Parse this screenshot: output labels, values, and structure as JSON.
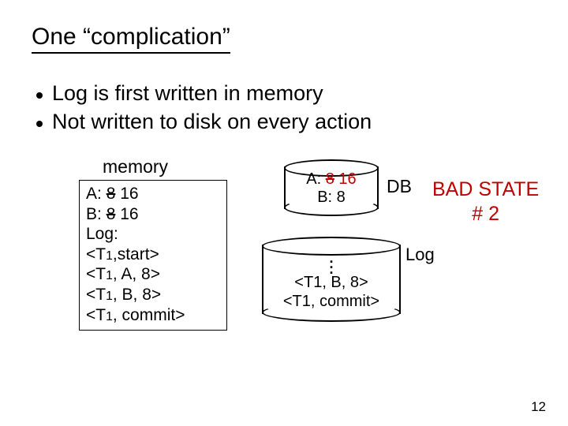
{
  "title": "One “complication”",
  "bullets": [
    "Log is first written in memory",
    "Not written to disk on every action"
  ],
  "memory": {
    "label": "memory",
    "lines": {
      "a_prefix": "A: ",
      "a_old": "8",
      "a_new": " 16",
      "b_prefix": "B: ",
      "b_old": "8",
      "b_new": " 16",
      "log_header": "Log:",
      "e1_open": "<T",
      "e1_sub": "1",
      "e1_rest": ",start>",
      "e2_open": "<T",
      "e2_sub": "1",
      "e2_rest": ", A, 8>",
      "e3_open": "<T",
      "e3_sub": "1",
      "e3_rest": ", B, 8>",
      "e4_open": "<T",
      "e4_sub": "1",
      "e4_rest": ", commit>"
    }
  },
  "db": {
    "label": "DB",
    "line1_prefix": "A: ",
    "line1_old": "8",
    "line1_new": " 16",
    "line2": "B: 8"
  },
  "log_disk": {
    "label": "Log",
    "line1": "<T1, B, 8>",
    "line2": "<T1, commit>"
  },
  "bad_state": {
    "line1": "BAD STATE",
    "line2": "# 2"
  },
  "slide_number": "12"
}
